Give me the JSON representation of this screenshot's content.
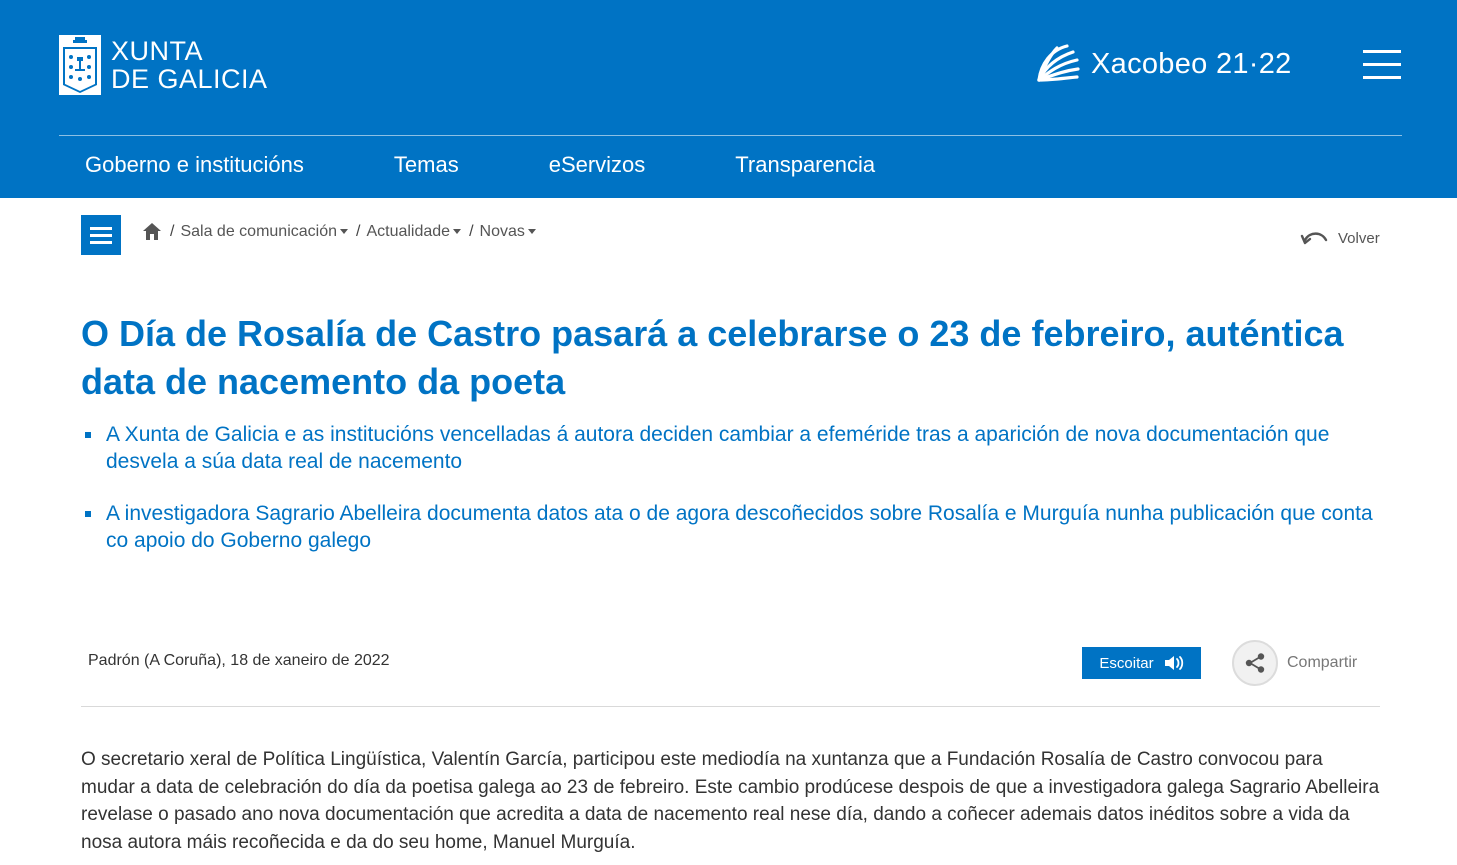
{
  "header": {
    "logo_line1": "XUNTA",
    "logo_line2": "DE GALICIA",
    "xacobeo": "Xacobeo 21·22",
    "menu_icon": "hamburger-icon",
    "colors": {
      "primary": "#0073c4",
      "background": "#ffffff",
      "text": "#333333"
    }
  },
  "nav": {
    "items": [
      {
        "label": "Goberno e institucións"
      },
      {
        "label": "Temas"
      },
      {
        "label": "eServizos"
      },
      {
        "label": "Transparencia"
      }
    ]
  },
  "breadcrumb": {
    "home_icon": "home-icon",
    "items": [
      {
        "label": "Sala de comunicación"
      },
      {
        "label": "Actualidade"
      },
      {
        "label": "Novas"
      }
    ]
  },
  "back": {
    "label": "Volver"
  },
  "article": {
    "title": "O Día de Rosalía de Castro pasará a celebrarse o 23 de febreiro, auténtica data de nacemento da poeta",
    "highlights": [
      "A Xunta de Galicia e as institucións vencelladas á autora deciden cambiar a efeméride tras a aparición de nova documentación que desvela a súa data real de nacemento",
      "A investigadora Sagrario Abelleira documenta datos ata o de agora descoñecidos sobre Rosalía e Murguía nunha publicación que conta co apoio do Goberno galego"
    ],
    "place_date": "Padrón (A Coruña), 18 de xaneiro de 2022",
    "listen_label": "Escoitar",
    "share_label": "Compartir",
    "body": "O secretario xeral de Política Lingüística, Valentín García, participou este mediodía na xuntanza que a Fundación Rosalía de Castro convocou para mudar a data de celebración do día da poetisa galega ao 23 de febreiro. Este cambio prodúcese despois de que a investigadora galega Sagrario Abelleira revelase o pasado ano nova documentación que acredita a data de nacemento real nese día, dando a coñecer ademais datos inéditos sobre a vida da nosa autora máis recoñecida e da do seu home, Manuel Murguía."
  }
}
